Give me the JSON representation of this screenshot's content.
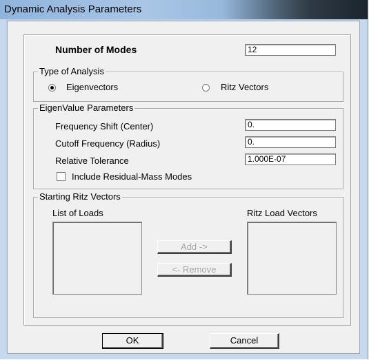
{
  "window": {
    "title": "Dynamic Analysis Parameters"
  },
  "modes": {
    "label": "Number of Modes",
    "value": "12"
  },
  "type_of_analysis": {
    "title": "Type of Analysis",
    "option_eigen": "Eigenvectors",
    "option_ritz": "Ritz Vectors",
    "selected": "Eigenvectors"
  },
  "eigen": {
    "title": "EigenValue Parameters",
    "freq_shift_label": "Frequency Shift  (Center)",
    "freq_shift_value": "0.",
    "cutoff_label": "Cutoff Frequency  (Radius)",
    "cutoff_value": "0.",
    "tolerance_label": "Relative Tolerance",
    "tolerance_value": "1.000E-07",
    "residual_label": "Include Residual-Mass Modes",
    "residual_checked": false
  },
  "ritz": {
    "title": "Starting Ritz Vectors",
    "list_of_loads": "List of Loads",
    "ritz_load_vectors": "Ritz Load Vectors",
    "add_label": "Add ->",
    "remove_label": "<- Remove"
  },
  "buttons": {
    "ok": "OK",
    "cancel": "Cancel"
  }
}
